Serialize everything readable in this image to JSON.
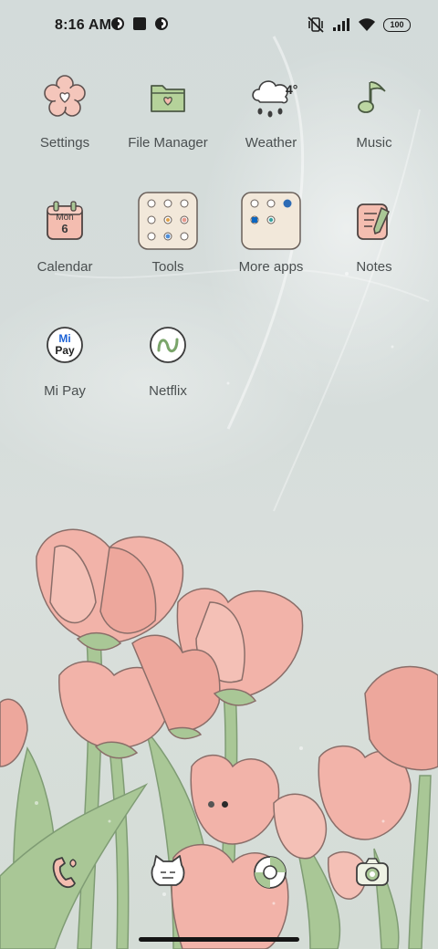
{
  "status": {
    "time": "8:16 AM",
    "battery": "100",
    "left_icons": [
      "notification-app-icon",
      "square-notification-icon",
      "notification-app-icon-2"
    ],
    "right_icons": [
      "mute-vibrate-icon",
      "cellular-signal-icon",
      "wifi-icon",
      "battery-icon"
    ]
  },
  "apps": {
    "settings": "Settings",
    "file_manager": "File Manager",
    "weather": "Weather",
    "weather_temp": "4°",
    "music": "Music",
    "calendar": "Calendar",
    "calendar_day": "Mon",
    "calendar_date": "6",
    "tools": "Tools",
    "more_apps": "More apps",
    "notes": "Notes",
    "mi_pay": "Mi Pay",
    "mi_pay_mi": "Mi",
    "mi_pay_pay": "Pay",
    "netflix": "Netflix"
  },
  "dock": [
    "phone-icon",
    "messages-cat-icon",
    "browser-icon",
    "camera-icon"
  ],
  "page_indicator": {
    "pages": 2,
    "current": 2
  },
  "colors": {
    "background": "#d5dcda",
    "tulip_pink": "#f2b3a9",
    "stem_green": "#a9c796",
    "icon_cream": "#f5ecdf",
    "label_text": "#4a4f50"
  }
}
